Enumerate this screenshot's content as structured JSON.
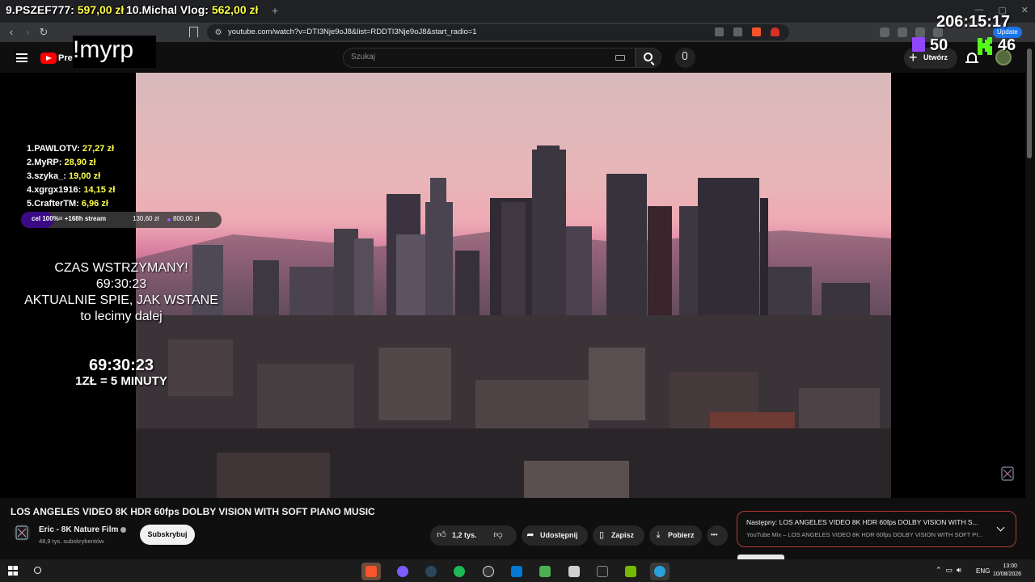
{
  "browser": {
    "url": "youtube.com/watch?v=DTI3Nje9oJ8&list=RDDTI3Nje9oJ8&start_radio=1",
    "update_label": "Update"
  },
  "youtube": {
    "brand": "Pre",
    "search_placeholder": "Szukaj",
    "create_label": "Utwórz"
  },
  "video": {
    "title": "LOS ANGELES VIDEO 8K HDR 60fps DOLBY VISION WITH SOFT PIANO MUSIC",
    "channel": "Eric - 8K Nature Film",
    "subscribers": "48,9 tys. subskrybentów",
    "subscribe_label": "Subskrybuj",
    "likes": "1,2 tys.",
    "share_label": "Udostępnij",
    "save_label": "Zapisz",
    "download_label": "Pobierz",
    "more_label": "•••"
  },
  "up_next": {
    "line1": "Następny: LOS ANGELES VIDEO 8K HDR 60fps DOLBY VISION WITH S...",
    "line2": "YouTube Mix – LOS ANGELES VIDEO 8K HDR 60fps DOLBY VISION WITH SOFT PI..."
  },
  "taskbar": {
    "lang": "ENG",
    "time": "13:00",
    "date": "10/08/2026"
  },
  "overlay": {
    "donors_top": [
      {
        "rank": "9.",
        "name": "PSZEF777: ",
        "amount": "597,00 zł"
      },
      {
        "rank": "10.",
        "name": "Michal Vlog: ",
        "amount": "562,00 zł"
      }
    ],
    "stream_timer": "206:15:17",
    "command": "!myrp",
    "twitch_viewers": "50",
    "kick_viewers": "46",
    "leaderboard": [
      {
        "rank": "1.",
        "name": "PAWLOTV: ",
        "amount": "27,27 zł"
      },
      {
        "rank": "2.",
        "name": "MyRP: ",
        "amount": "28,90 zł"
      },
      {
        "rank": "3.",
        "name": "szyka_: ",
        "amount": "19,00 zł"
      },
      {
        "rank": "4.",
        "name": "xgrgx1916: ",
        "amount": "14,15 zł"
      },
      {
        "rank": "5.",
        "name": "CrafterTM: ",
        "amount": "6,96 zł"
      }
    ],
    "goal": {
      "label": "cel 100%= +168h stream",
      "current": "130,60 zł",
      "target": "800,00 zł",
      "progress": 0.163
    },
    "pause_lines": [
      "CZAS WSTRZYMANY!",
      "69:30:23",
      "AKTUALNIE SPIE, JAK WSTANE",
      "to lecimy dalej"
    ],
    "pause_timer": "69:30:23",
    "rate": "1ZŁ = 5 MINUTY"
  },
  "colors": {
    "donation_amount": "#ffff4a",
    "youtube_red": "#ff0000",
    "twitch_purple": "#9146ff",
    "kick_green": "#53fc18",
    "goal_fill": "#3b0a85"
  }
}
